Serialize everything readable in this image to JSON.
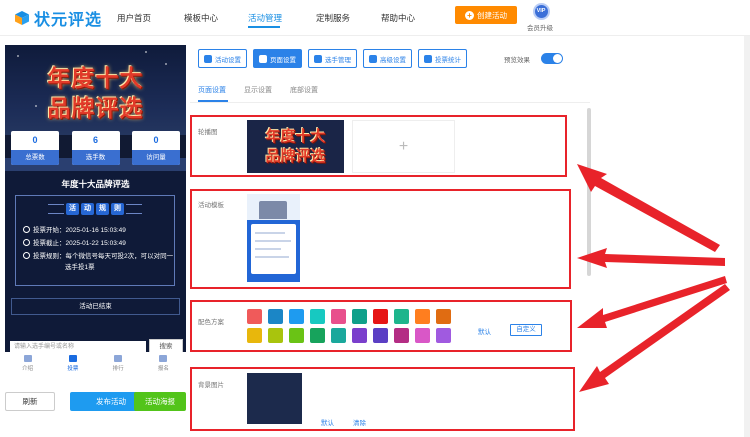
{
  "nav": {
    "logo_text": "状元评选",
    "items": [
      "用户首页",
      "模板中心",
      "活动管理",
      "定制服务",
      "帮助中心"
    ],
    "active_index": 2,
    "create_button": "创建活动",
    "vip_badge": "VIP",
    "vip_label": "会员升级"
  },
  "preview": {
    "banner_line1": "年度十大",
    "banner_line2": "品牌评选",
    "stats": [
      {
        "value": "0",
        "label": "总票数"
      },
      {
        "value": "6",
        "label": "选手数"
      },
      {
        "value": "0",
        "label": "访问量"
      }
    ],
    "title": "年度十大品牌评选",
    "rules_heading": [
      "活",
      "动",
      "规",
      "则"
    ],
    "rules": [
      "投票开始：2025-01-16 15:03:49",
      "投票截止：2025-01-22 15:03:49",
      "投票规则：每个微信号每天可投2次，可以对同一",
      "选手投1票"
    ],
    "end_text": "活动已结束",
    "search_placeholder": "请输入选手编号或名称",
    "search_button": "搜索",
    "tabs": [
      "介绍",
      "投票",
      "排行",
      "报名"
    ],
    "active_tab": 1
  },
  "actions": {
    "refresh": "刷新",
    "publish": "发布活动",
    "poster": "活动海报"
  },
  "toolbar": {
    "buttons": [
      "活动设置",
      "页面设置",
      "选手管理",
      "高级设置",
      "投票统计"
    ],
    "active_index": 1,
    "preview_label": "预览效果",
    "preview_on": true
  },
  "subtabs": {
    "items": [
      "页面设置",
      "显示设置",
      "底部设置"
    ],
    "active_index": 0
  },
  "sections": {
    "carousel_label": "轮播图",
    "carousel_img_line1": "年度十大",
    "carousel_img_line2": "品牌评选",
    "add_symbol": "+",
    "template_label": "活动模板",
    "color_label": "配色方案",
    "color_default": "默认",
    "color_custom": "自定义",
    "bg_label": "背景图片",
    "bg_default": "默认",
    "bg_clear": "清除"
  },
  "colors": {
    "accent": "#2b82e8",
    "highlight_border": "#e8232a",
    "orange": "#ff8a00",
    "green": "#52c41a",
    "swatches": [
      "#f05a5a",
      "#1b86c6",
      "#1e9bf0",
      "#17c9c1",
      "#e84f8c",
      "#0fa08a",
      "#e61515",
      "#1db58c",
      "#ff7e1f",
      "#e06c12",
      "#e8b70c",
      "#a9c40d",
      "#6ac315",
      "#17a35c",
      "#1aa89c",
      "#7a3fcc",
      "#5b3fc4",
      "#b42d84",
      "#d957c7",
      "#a05ae0"
    ]
  },
  "icons": {
    "logo": "cube-logo-icon",
    "create": "plus-circle-icon",
    "toolbar": [
      "gear-icon",
      "page-gear-icon",
      "users-icon",
      "sliders-icon",
      "bar-chart-icon"
    ],
    "tabs": [
      "doc-icon",
      "flag-icon",
      "chart-icon",
      "signup-icon"
    ]
  }
}
